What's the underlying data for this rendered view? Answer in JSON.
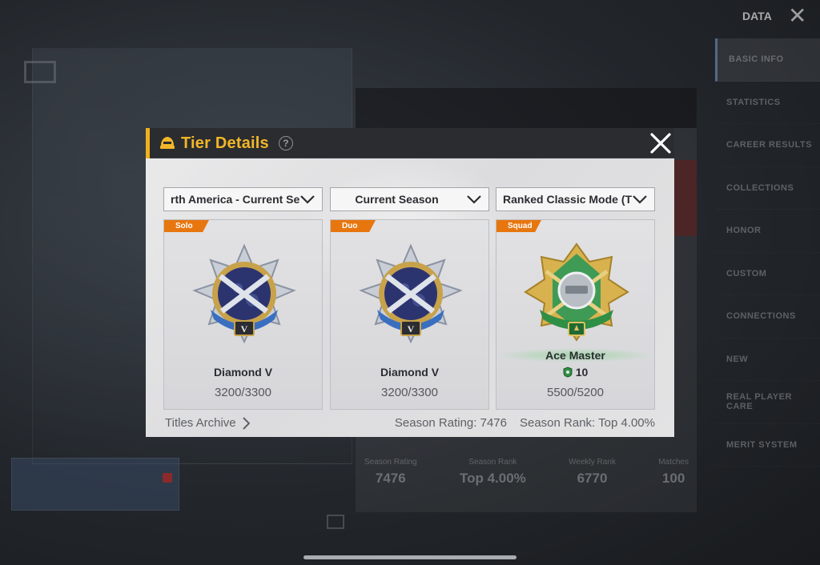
{
  "background": {
    "data_title": "DATA",
    "sidebar_items": [
      {
        "label": "BASIC INFO",
        "active": true
      },
      {
        "label": "STATISTICS",
        "active": false
      },
      {
        "label": "CAREER RESULTS",
        "active": false
      },
      {
        "label": "COLLECTIONS",
        "active": false
      },
      {
        "label": "HONOR",
        "active": false
      },
      {
        "label": "CUSTOM",
        "active": false
      },
      {
        "label": "CONNECTIONS",
        "active": false
      },
      {
        "label": "NEW",
        "active": false
      },
      {
        "label": "REAL PLAYER CARE",
        "active": false
      },
      {
        "label": "MERIT SYSTEM",
        "active": false
      }
    ],
    "stats": [
      {
        "label": "Season Rating",
        "value": "7476"
      },
      {
        "label": "Season Rank",
        "value": "Top 4.00%"
      },
      {
        "label": "Weekly Rank",
        "value": "6770"
      },
      {
        "label": "Matches",
        "value": "100"
      }
    ]
  },
  "dialog": {
    "title": "Tier Details",
    "help_glyph": "?",
    "accent_color": "#f0b020",
    "title_color": "#f2b628",
    "filters": {
      "server": "rth America - Current Serv",
      "season": "Current Season",
      "mode": "Ranked Classic Mode (TPP)"
    },
    "cards": [
      {
        "badge": "Solo",
        "tier": "Diamond V",
        "points": "3200/3300",
        "icon": "diamond-emblem-icon"
      },
      {
        "badge": "Duo",
        "tier": "Diamond V",
        "points": "3200/3300",
        "icon": "diamond-emblem-icon"
      },
      {
        "badge": "Squad",
        "tier": "Ace Master",
        "level": "10",
        "points": "5500/5200",
        "icon": "ace-master-emblem-icon"
      }
    ],
    "titles_archive": "Titles Archive",
    "season_rating": "Season Rating: 7476",
    "season_rank": "Season Rank: Top 4.00%"
  }
}
